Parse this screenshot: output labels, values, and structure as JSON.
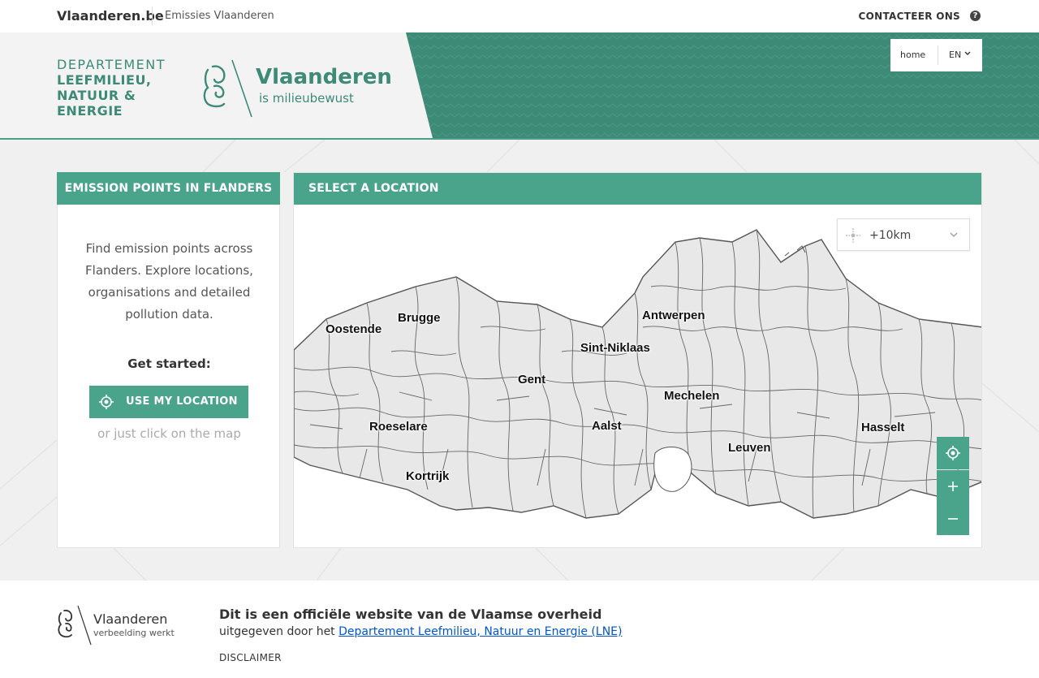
{
  "topbar": {
    "brand": "Vlaanderen.be",
    "site": "Emissies Vlaanderen",
    "contact": "CONTACTEER ONS",
    "help": "?"
  },
  "header": {
    "dept_line1": "DEPARTEMENT",
    "dept_line2": "LEEFMILIEU,",
    "dept_line3": "NATUUR &",
    "dept_line4": "ENERGIE",
    "logo_name": "Vlaanderen",
    "logo_tagline": "is milieubewust",
    "nav_home": "home",
    "nav_lang": "EN"
  },
  "left_panel": {
    "title": "EMISSION POINTS IN FLANDERS",
    "intro": "Find emission points across Flanders. Explore locations, organisations and detailed pollution data.",
    "get_started": "Get started:",
    "use_location": "USE MY LOCATION",
    "hint": "or just click on the map"
  },
  "map_panel": {
    "title": "SELECT A LOCATION",
    "radius": "+10km",
    "cities": [
      "Oostende",
      "Brugge",
      "Antwerpen",
      "Sint-Niklaas",
      "Gent",
      "Mechelen",
      "Roeselare",
      "Aalst",
      "Hasselt",
      "Leuven",
      "Kortrijk"
    ]
  },
  "footer": {
    "logo_name": "Vlaanderen",
    "logo_tagline": "verbeelding werkt",
    "official": "Dit is een officiële website van de Vlaamse overheid",
    "published_by": "uitgegeven door het",
    "publisher_link": "Departement Leefmilieu, Natuur en Energie (LNE)",
    "disclaimer": "DISCLAIMER"
  },
  "colors": {
    "accent": "#4aa48c",
    "header_green": "#3d8a77",
    "map_fill": "#e8e8e8",
    "map_stroke": "#555555"
  },
  "icons": [
    "help-icon",
    "lion-logo-icon",
    "chevron-down-icon",
    "crosshair-icon",
    "locate-icon",
    "zoom-in-icon",
    "zoom-out-icon"
  ]
}
